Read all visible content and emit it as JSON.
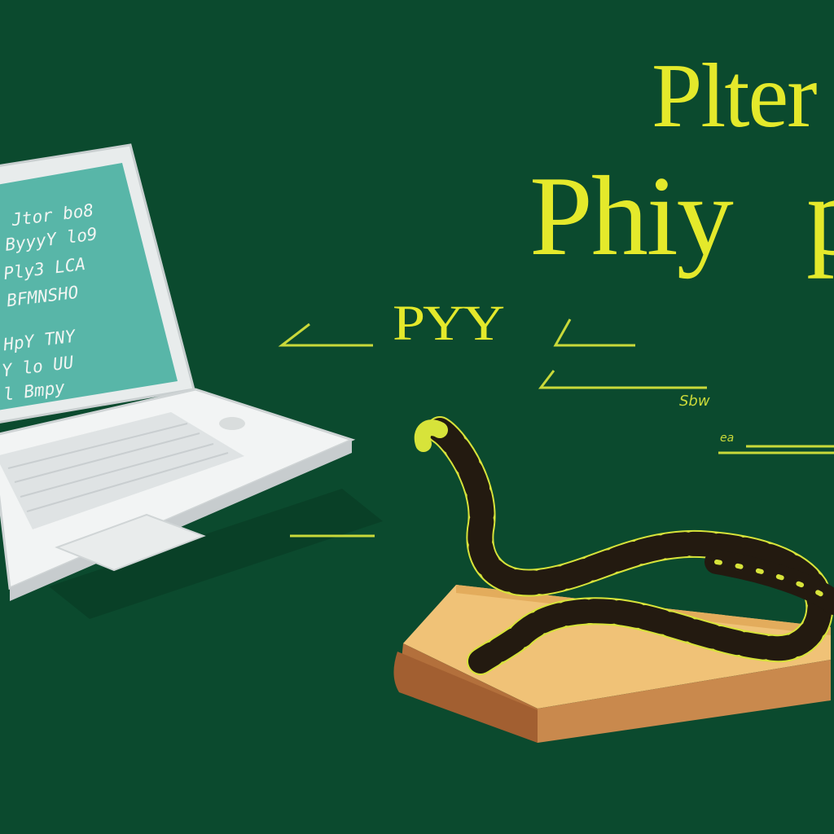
{
  "scene": {
    "background": "#0b4a2e",
    "accent": "#e4e92b",
    "screen_color": "#58b6a8",
    "book_color": "#c9894d",
    "snake_colors": [
      "#231a10",
      "#d7e33a"
    ]
  },
  "title": {
    "line1": "Plter",
    "line2": "Phiy",
    "line3": "p",
    "small": "PYY"
  },
  "laptop": {
    "screen_lines": [
      "Jtor  bo8",
      "ByyyY  lo9",
      "Ply3  LCA",
      "BFMNSHO",
      "",
      "HpY TNY",
      "Y     lo UU",
      "l Bmpy"
    ]
  },
  "deco_labels": {
    "label1": "Sbw",
    "label2": "ea"
  },
  "icons": {
    "laptop": "laptop-icon",
    "book": "book-icon",
    "snake": "snake-icon"
  }
}
